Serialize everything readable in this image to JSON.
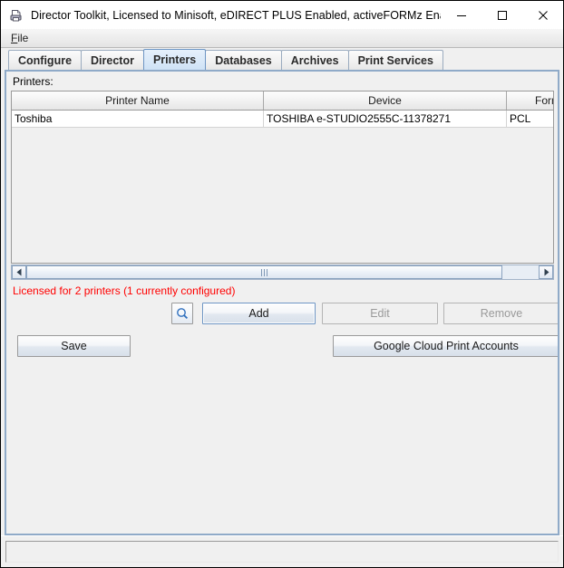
{
  "window": {
    "title": "Director Toolkit, Licensed to Minisoft, eDIRECT PLUS Enabled, activeFORMz Enabled",
    "icon": "printer-document-icon",
    "controls": {
      "minimize": "minimize-icon",
      "maximize": "maximize-icon",
      "close": "close-icon"
    }
  },
  "menubar": {
    "items": [
      {
        "label": "File",
        "mnemonic": "F",
        "rest": "ile"
      }
    ]
  },
  "tabs": [
    {
      "label": "Configure",
      "selected": false
    },
    {
      "label": "Director",
      "selected": false
    },
    {
      "label": "Printers",
      "selected": true
    },
    {
      "label": "Databases",
      "selected": false
    },
    {
      "label": "Archives",
      "selected": false
    },
    {
      "label": "Print Services",
      "selected": false
    }
  ],
  "panel": {
    "section_label": "Printers:"
  },
  "table": {
    "columns": [
      "Printer Name",
      "Device",
      "Format"
    ],
    "rows": [
      {
        "printer_name": "Toshiba",
        "device": "TOSHIBA e-STUDIO2555C-11378271",
        "format": "PCL"
      }
    ]
  },
  "scrollbar": {
    "left_arrow": "triangle-left-icon",
    "right_arrow": "triangle-right-icon",
    "grip": "grip-lines-icon"
  },
  "license": {
    "text": "Licensed for 2 printers (1 currently configured)",
    "color": "#ff0000"
  },
  "buttons": {
    "search": {
      "label": "",
      "icon": "magnifier-icon",
      "enabled": true
    },
    "add": {
      "label": "Add",
      "enabled": true,
      "focused": true
    },
    "edit": {
      "label": "Edit",
      "enabled": false
    },
    "remove": {
      "label": "Remove",
      "enabled": false
    },
    "save": {
      "label": "Save",
      "enabled": true
    },
    "google_cloud_print": {
      "label": "Google Cloud Print Accounts",
      "enabled": true
    }
  },
  "statusbar": {
    "text": ""
  },
  "colors": {
    "accent": "#6d95c4",
    "panel_border": "#8faac8",
    "tab_selected_bg": "#d8e8f8",
    "error_text": "#ff0000",
    "window_bg": "#f0f0f0"
  }
}
